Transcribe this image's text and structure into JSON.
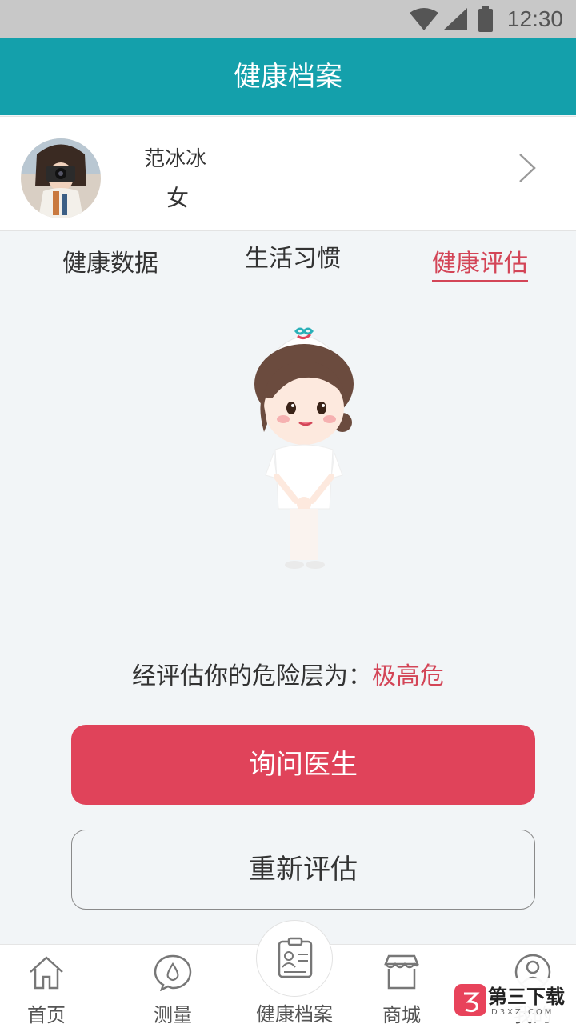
{
  "status_bar": {
    "time": "12:30"
  },
  "header": {
    "title": "健康档案"
  },
  "profile": {
    "name": "范冰冰",
    "gender": "女"
  },
  "tabs": [
    {
      "label": "健康数据",
      "active": false
    },
    {
      "label": "生活习惯",
      "active": false
    },
    {
      "label": "健康评估",
      "active": true
    }
  ],
  "assessment": {
    "prefix": "经评估你的危险层为：",
    "risk_level": "极高危"
  },
  "buttons": {
    "ask_doctor": "询问医生",
    "reassess": "重新评估"
  },
  "bottom_nav": [
    {
      "label": "首页",
      "icon": "home-icon"
    },
    {
      "label": "测量",
      "icon": "drop-chat-icon"
    },
    {
      "label": "健康档案",
      "icon": "clipboard-icon"
    },
    {
      "label": "商城",
      "icon": "shop-icon"
    },
    {
      "label": "我的",
      "icon": "user-icon"
    }
  ],
  "watermark": {
    "brand": "第三下载",
    "domain": "D3XZ.COM"
  },
  "colors": {
    "header": "#14a0ab",
    "accent": "#e0435a",
    "risk": "#d34557"
  }
}
